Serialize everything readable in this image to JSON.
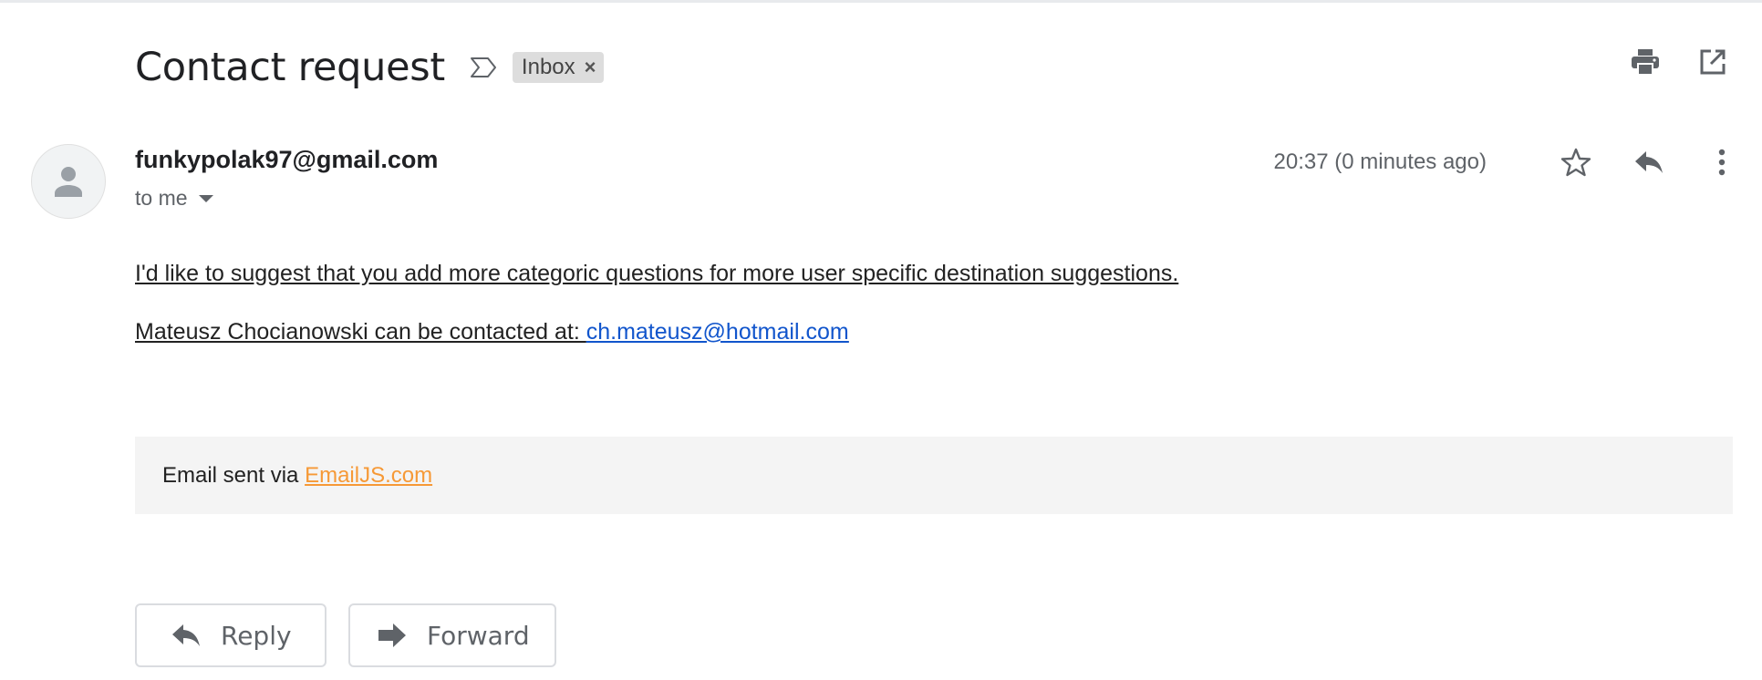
{
  "header": {
    "subject": "Contact request",
    "label": "Inbox",
    "label_remove": "×"
  },
  "message": {
    "sender": "funkypolak97@gmail.com",
    "recipient": "to me",
    "time": "20:37 (0 minutes ago)",
    "body_line1": "I'd like to suggest that you add more categoric questions for more user specific destination suggestions.",
    "body_line2_prefix": "Mateusz Chocianowski can be contacted at: ",
    "contact_email": "ch.mateusz@hotmail.com",
    "footer_prefix": "Email sent via ",
    "footer_link": "EmailJS.com"
  },
  "actions": {
    "reply_label": "Reply",
    "forward_label": "Forward"
  },
  "icons": {
    "important": "important-marker-icon",
    "print": "print-icon",
    "open_new_window": "open-in-new-icon",
    "star": "star-icon",
    "reply": "reply-icon",
    "more": "more-vert-icon",
    "forward": "forward-icon",
    "avatar": "person-icon"
  },
  "colors": {
    "link": "#1155cc",
    "footer_link": "#f69936",
    "footer_bg": "#f4f4f4",
    "chip_bg": "#dddddd"
  }
}
